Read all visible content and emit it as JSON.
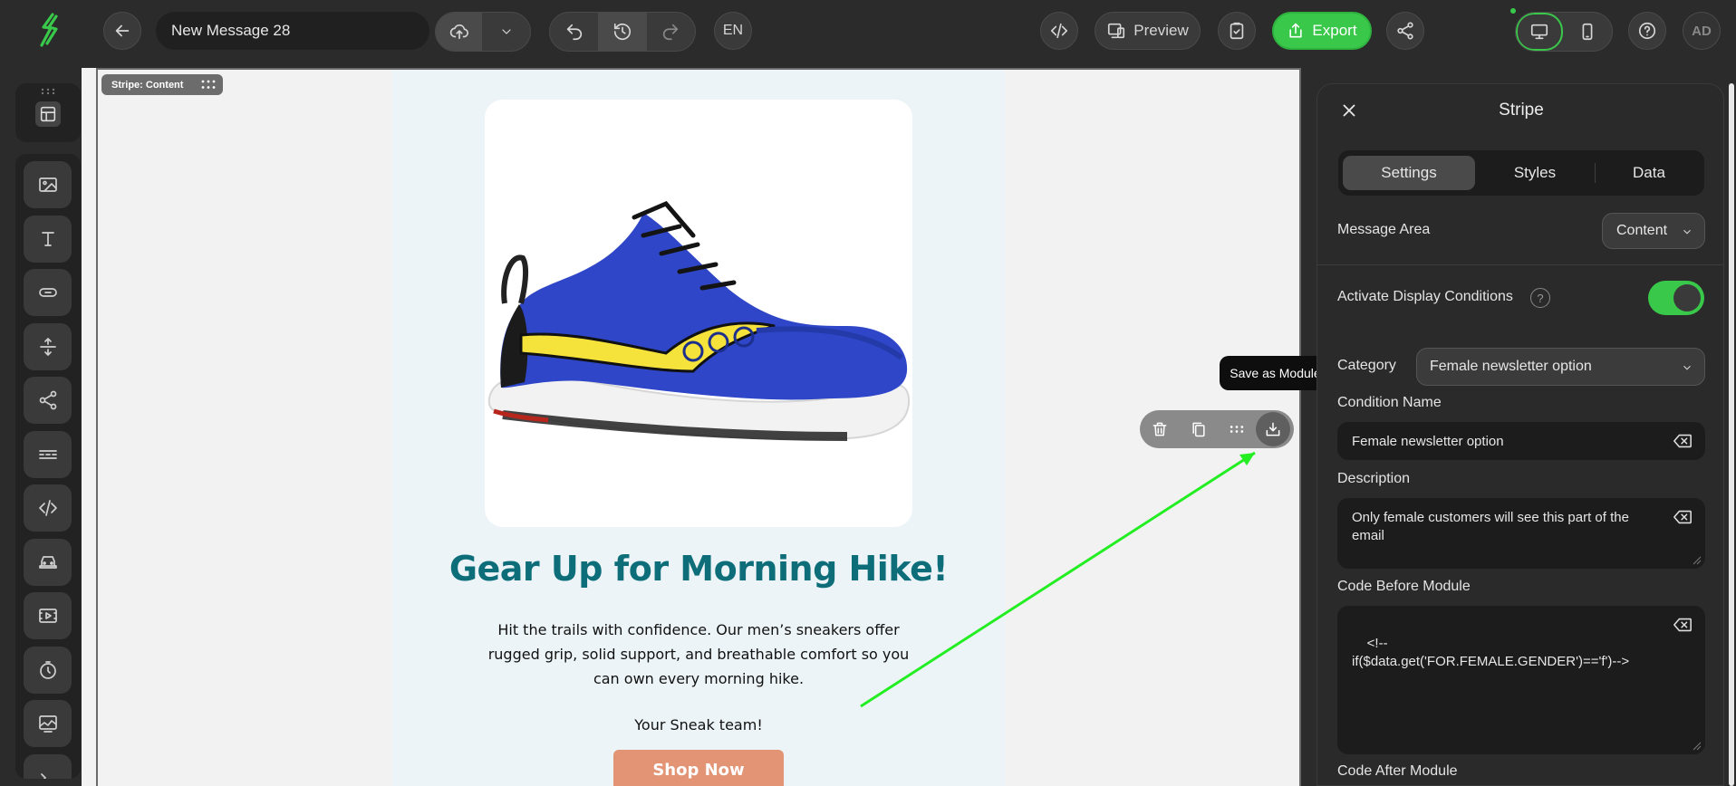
{
  "topbar": {
    "message_title": "New Message 28",
    "language": "EN",
    "preview_label": "Preview",
    "export_label": "Export",
    "avatar_initials": "AD"
  },
  "canvas": {
    "stripe_tag": "Stripe: Content",
    "headline": "Gear Up for Morning Hike!",
    "body_text": "Hit the trails with confidence. Our men’s sneakers offer rugged grip, solid support, and breathable comfort so you can own every morning hike.",
    "signoff": "Your Sneak team!",
    "cta_label": "Shop Now",
    "tooltip": "Save as Module"
  },
  "panel": {
    "title": "Stripe",
    "tabs": [
      {
        "label": "Settings"
      },
      {
        "label": "Styles"
      },
      {
        "label": "Data"
      }
    ],
    "message_area_label": "Message Area",
    "message_area_value": "Content",
    "display_conditions_label": "Activate Display Conditions",
    "display_conditions_enabled": true,
    "help_glyph": "?",
    "category_label": "Category",
    "category_value": "Female newsletter option",
    "condition_name_label": "Condition Name",
    "condition_name_value": "Female newsletter option",
    "description_label": "Description",
    "description_value": "Only female customers will see this part of the email",
    "code_before_label": "Code Before Module",
    "code_before_value": "<!--\nif($data.get('FOR.FEMALE.GENDER')=='f')-->",
    "code_after_label": "Code After Module"
  },
  "colors": {
    "accent_green": "#39c84a",
    "headline_teal": "#0d6e7a",
    "cta_salmon": "#e29474",
    "annotation_arrow": "#22ee22"
  }
}
